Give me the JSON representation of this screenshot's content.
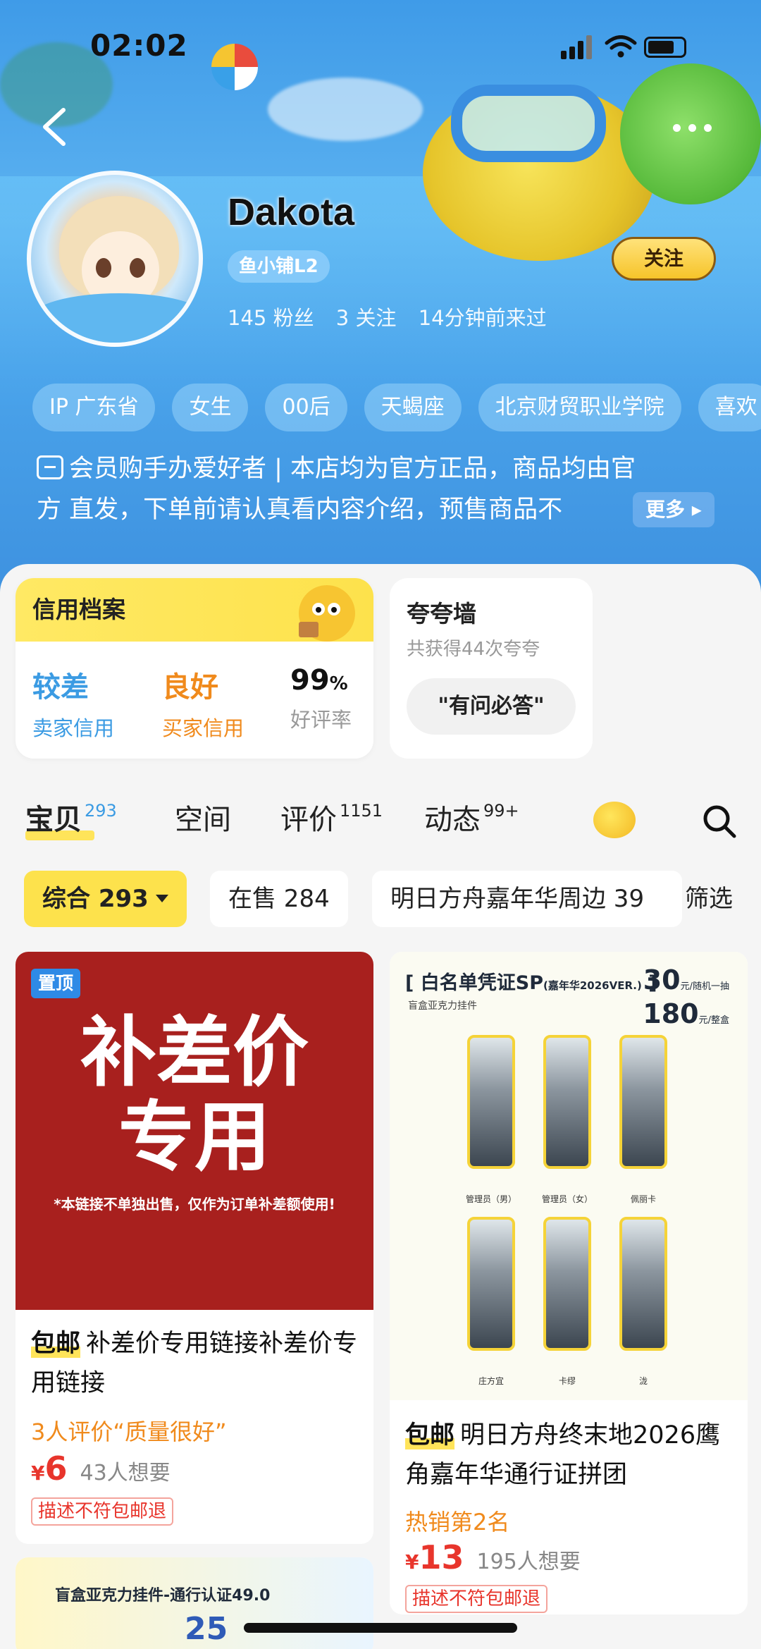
{
  "status_bar": {
    "time": "02:02"
  },
  "profile": {
    "name": "Dakota",
    "level": "鱼小铺L2",
    "fans": "145 粉丝",
    "following": "3 关注",
    "last_seen": "14分钟前来过",
    "follow_label": "关注"
  },
  "tags": [
    "IP 广东省",
    "女生",
    "00后",
    "天蝎座",
    "北京财贸职业学院",
    "喜欢"
  ],
  "bio": {
    "line1": "会员购手办爱好者 | 本店均为官方正品，商品均由官",
    "line2": "方 直发，下单前请认真看内容介绍，预售商品不",
    "more_label": "更多"
  },
  "credit": {
    "title": "信用档案",
    "seller_value": "较差",
    "seller_label": "卖家信用",
    "buyer_value": "良好",
    "buyer_label": "买家信用",
    "rating_value": "99",
    "rating_unit": "%",
    "rating_label": "好评率",
    "colors": {
      "seller": "#3b9be3",
      "buyer": "#f08a1c"
    }
  },
  "praise": {
    "title": "夸夸墙",
    "subtitle": "共获得44次夸夸",
    "pill": "\"有问必答\""
  },
  "tabs": [
    {
      "label": "宝贝",
      "count": "293"
    },
    {
      "label": "空间",
      "count": ""
    },
    {
      "label": "评价",
      "count": "1151"
    },
    {
      "label": "动态",
      "count": "99+"
    }
  ],
  "filters": {
    "chips": [
      "综合 293",
      "在售 284",
      "明日方舟嘉年华周边 39"
    ],
    "filter_label": "筛选"
  },
  "products": [
    {
      "pin": "置顶",
      "image_text_1": "补差价",
      "image_text_2": "专用",
      "image_note": "*本链接不单独出售，仅作为订单补差额使用!",
      "mail": "包邮",
      "title": "补差价专用链接补差价专用链接",
      "highlight": "3人评价“质量很好”",
      "currency": "¥",
      "price": "6",
      "wants": "43人想要",
      "return_tag": "描述不符包邮退"
    },
    {
      "poster_title": "白名单凭证SP",
      "poster_title_small": "(嘉年华2026VER.)",
      "poster_sub": "盲盒亚克力挂件",
      "poster_price_1": "30",
      "poster_price_1_unit": "元/随机一抽",
      "poster_price_2": "180",
      "poster_price_2_unit": "元/整盒",
      "charm_labels": [
        "管理员（男）",
        "管理员（女）",
        "佩丽卡",
        "庄方宜",
        "卡缪",
        "泷"
      ],
      "mail": "包邮",
      "title": "明日方舟终末地2026鹰角嘉年华通行证拼团",
      "highlight": "热销第2名",
      "currency": "¥",
      "price": "13",
      "wants": "195人想要",
      "return_tag": "描述不符包邮退"
    }
  ],
  "bottom_card": {
    "title": "盲盒亚克力挂件-通行认证49.0",
    "price_text": "25"
  }
}
